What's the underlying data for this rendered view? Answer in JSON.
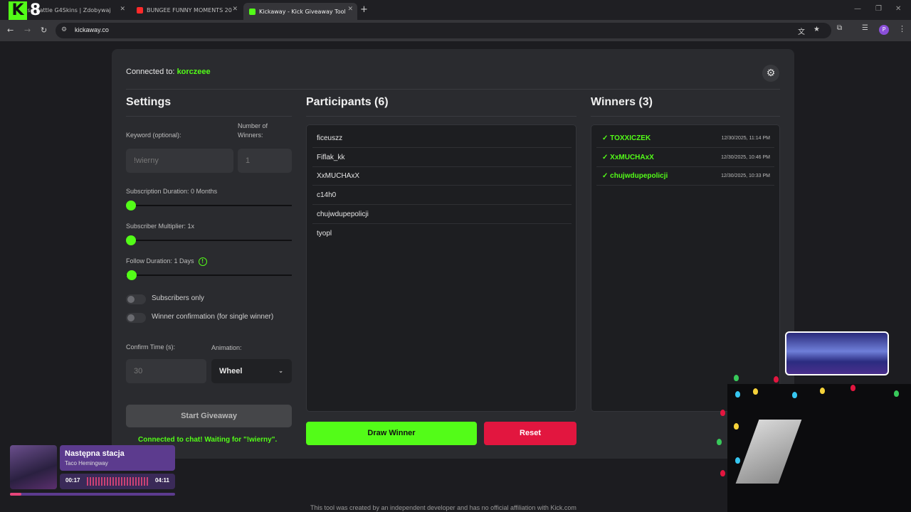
{
  "browser": {
    "tabs": [
      {
        "label": "Case Battle G4Skins | Zdobywaj",
        "active": false,
        "color": "#e2163f"
      },
      {
        "label": "BUNGEE FUNNY MOMENTS 20",
        "active": false,
        "color": "#ff0000"
      },
      {
        "label": "Kickaway - Kick Giveaway Tool",
        "active": true,
        "color": "#53fc18"
      }
    ],
    "url": "kickaway.co",
    "profile_initial": "P"
  },
  "header": {
    "connected_prefix": "Connected to: ",
    "channel": "korczeee"
  },
  "settings": {
    "title": "Settings",
    "keyword_label": "Keyword (optional):",
    "keyword_value": "!wierny",
    "winners_label": "Number of Winners:",
    "winners_value": "1",
    "subscription_label": "Subscription Duration: 0 Months",
    "subscription_value": 0,
    "multiplier_label": "Subscriber Multiplier: 1x",
    "multiplier_value": 1,
    "follow_label": "Follow Duration: 1 Days",
    "follow_value": 1,
    "info_glyph": "!",
    "subscribers_only_label": "Subscribers only",
    "subscribers_only": false,
    "winner_confirmation_label": "Winner confirmation (for single winner)",
    "winner_confirmation": false,
    "confirm_time_label": "Confirm Time (s):",
    "confirm_time_value": "30",
    "animation_label": "Animation:",
    "animation_value": "Wheel",
    "start_button": "Start Giveaway",
    "status": "Connected to chat! Waiting for \"!wierny\"."
  },
  "participants": {
    "title": "Participants (6)",
    "items": [
      "ficeuszz",
      "Fiflak_kk",
      "XxMUCHAxX",
      "c14h0",
      "chujwdupepolicji",
      "tyopl"
    ]
  },
  "winners": {
    "title": "Winners (3)",
    "items": [
      {
        "name": "✓ TOXXICZEK",
        "time": "12/30/2025, 11:14 PM"
      },
      {
        "name": "✓ XxMUCHAxX",
        "time": "12/30/2025, 10:46 PM"
      },
      {
        "name": "✓ chujwdupepolicji",
        "time": "12/30/2025, 10:33 PM"
      }
    ]
  },
  "actions": {
    "draw": "Draw Winner",
    "reset": "Reset"
  },
  "footer": "This tool was created by an independent developer and has no official affiliation with Kick.com",
  "overlay": {
    "logo_letter": "K",
    "logo_number": "8",
    "song": "Następna stacja",
    "artist": "Taco Hemingway",
    "elapsed": "00:17",
    "total": "04:11",
    "progress": 0.07
  },
  "colors": {
    "accent": "#53fc18",
    "danger": "#e2163f",
    "card": "#2a2b2f"
  }
}
